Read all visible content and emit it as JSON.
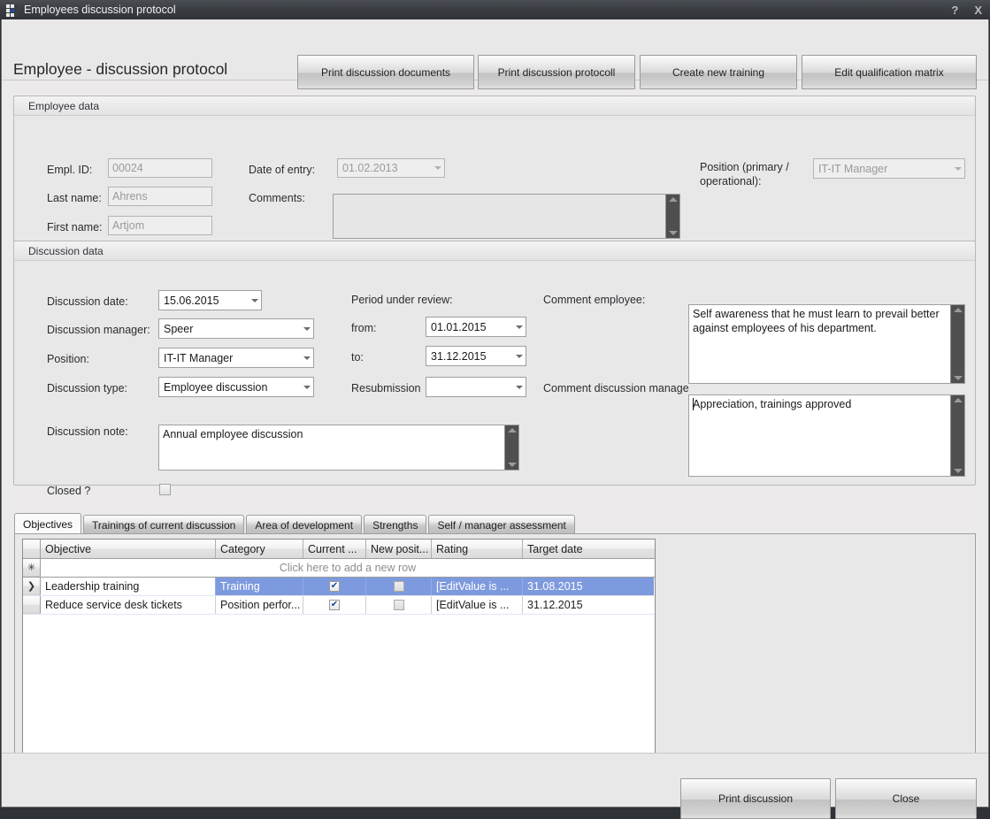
{
  "window": {
    "title": "Employees discussion protocol",
    "help_button": "?",
    "close_button": "X"
  },
  "header": {
    "page_title": "Employee - discussion protocol",
    "buttons": [
      {
        "label": "Print discussion documents"
      },
      {
        "label": "Print discussion protocoll"
      },
      {
        "label": "Create new training"
      },
      {
        "label": "Edit qualification matrix"
      }
    ]
  },
  "employee_data": {
    "caption": "Employee data",
    "fields": {
      "empl_id_label": "Empl. ID:",
      "empl_id_value": "00024",
      "last_name_label": "Last name:",
      "last_name_value": "Ahrens",
      "first_name_label": "First name:",
      "first_name_value": "Artjom",
      "date_of_entry_label": "Date of entry:",
      "date_of_entry_value": "01.02.2013",
      "comments_label": "Comments:",
      "comments_value": "",
      "position_label": "Position (primary / operational):",
      "position_label_line1": "Position (primary /",
      "position_label_line2": "operational):",
      "position_value": "IT-IT Manager"
    }
  },
  "discussion_data": {
    "caption": "Discussion data",
    "fields": {
      "discussion_date_label": "Discussion date:",
      "discussion_date_value": "15.06.2015",
      "discussion_manager_label": "Discussion manager:",
      "discussion_manager_value": "Speer",
      "position_label": "Position:",
      "position_value": "IT-IT Manager",
      "discussion_type_label": "Discussion type:",
      "discussion_type_value": "Employee discussion",
      "discussion_note_label": "Discussion note:",
      "discussion_note_value": "Annual employee discussion",
      "closed_label": "Closed ?",
      "closed_checked": false,
      "period_label": "Period under review:",
      "from_label": "from:",
      "from_value": "01.01.2015",
      "to_label": "to:",
      "to_value": "31.12.2015",
      "resubmission_label": "Resubmission",
      "resubmission_value": "",
      "comment_employee_label": "Comment employee:",
      "comment_employee_value": "Self awareness that he must learn to prevail better against employees of his department.",
      "comment_manager_label": "Comment discussion manage",
      "comment_manager_value": "Appreciation, trainings approved"
    }
  },
  "tabs": [
    {
      "label": "Objectives",
      "active": true
    },
    {
      "label": "Trainings of current discussion",
      "active": false
    },
    {
      "label": "Area of development",
      "active": false
    },
    {
      "label": "Strengths",
      "active": false
    },
    {
      "label": "Self / manager assessment",
      "active": false
    }
  ],
  "grid": {
    "columns": [
      "Objective",
      "Category",
      "Current ...",
      "New posit...",
      "Rating",
      "Target date"
    ],
    "new_row_text": "Click here to add a new row",
    "new_row_marker": "✳",
    "current_row_marker": "❯",
    "rows": [
      {
        "selected": true,
        "marker": "❯",
        "objective": "Leadership training",
        "category": "Training",
        "current": true,
        "new_position": false,
        "rating": "[EditValue is ...",
        "target_date": "31.08.2015"
      },
      {
        "selected": false,
        "marker": "",
        "objective": "Reduce service desk tickets",
        "category": "Position perfor...",
        "current": true,
        "new_position": false,
        "rating": "[EditValue is ...",
        "target_date": "31.12.2015"
      }
    ]
  },
  "footer": {
    "print_button": "Print discussion",
    "close_button": "Close"
  },
  "colors": {
    "selection_blue": "#7e9ade",
    "titlebar": "#3b3e43",
    "surface": "#e9e8e8"
  }
}
